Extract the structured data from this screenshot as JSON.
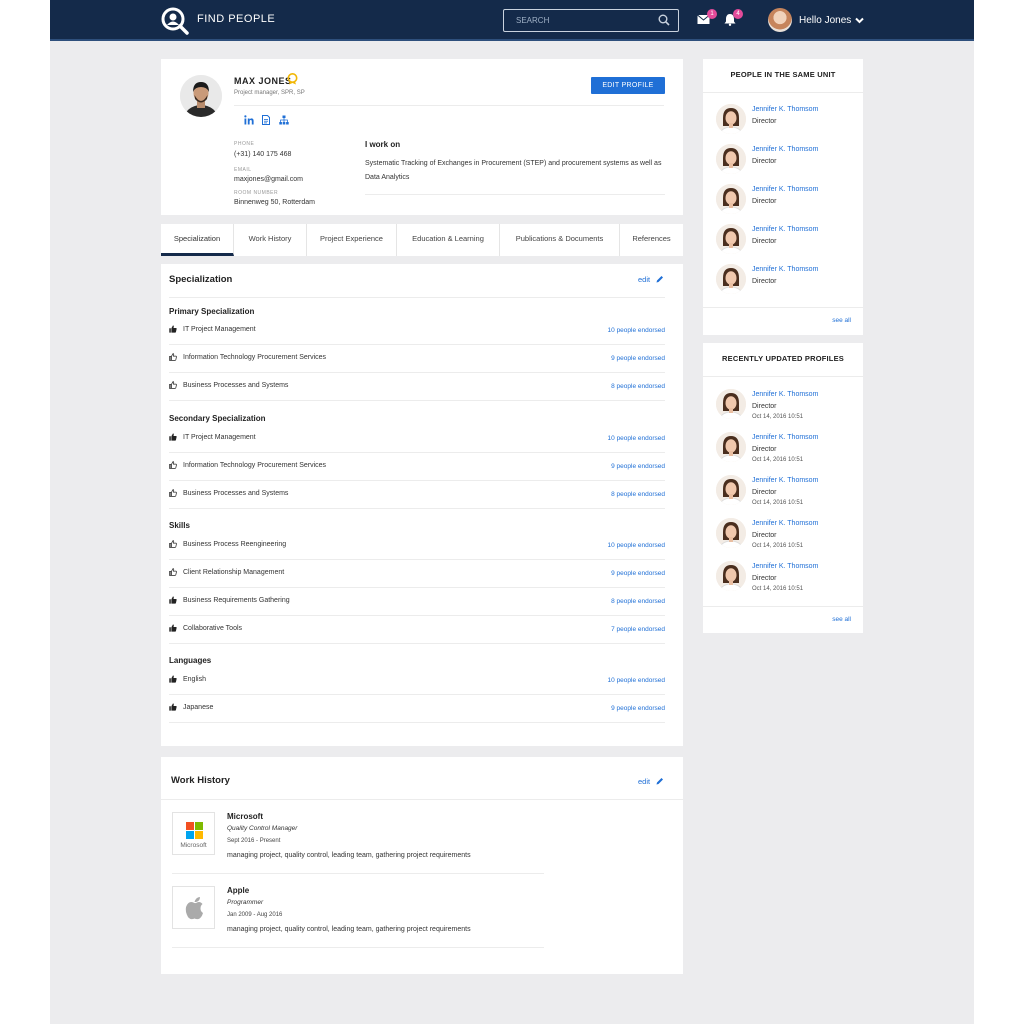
{
  "header": {
    "brand": "FIND PEOPLE",
    "search_placeholder": "SEARCH",
    "mail_count": "1",
    "notif_count": "4",
    "greeting": "Hello Jones"
  },
  "profile": {
    "name": "MAX JONES",
    "title": "Project manager, SPR, SP",
    "edit_label": "EDIT PROFILE",
    "phone_label": "PHONE",
    "phone": "(+31) 140 175 468",
    "email_label": "EMAIL",
    "email": "maxjones@gmail.com",
    "room_label": "ROOM NUMBER",
    "room": "Binnenweg 50, Rotterdam",
    "work_on_title": "I work on",
    "work_on_text": "Systematic Tracking of Exchanges in Procurement (STEP) and procurement systems as well as Data Analytics",
    "social": [
      "linkedin-icon",
      "document-icon",
      "org-chart-icon"
    ]
  },
  "tabs": [
    "Specialization",
    "Work History",
    "Project Experience",
    "Education & Learning",
    "Publications & Documents",
    "References"
  ],
  "specialization": {
    "title": "Specialization",
    "edit_label": "edit",
    "groups": [
      {
        "title": "Primary Specialization",
        "items": [
          {
            "label": "IT Project Management",
            "endorsed": "10 people endorsed",
            "filled": true
          },
          {
            "label": "Information Technology Procurement Services",
            "endorsed": "9 people endorsed",
            "filled": false
          },
          {
            "label": "Business Processes and Systems",
            "endorsed": "8 people endorsed",
            "filled": false
          }
        ]
      },
      {
        "title": "Secondary Specialization",
        "items": [
          {
            "label": "IT Project Management",
            "endorsed": "10 people endorsed",
            "filled": true
          },
          {
            "label": "Information Technology Procurement Services",
            "endorsed": "9 people endorsed",
            "filled": false
          },
          {
            "label": "Business Processes and Systems",
            "endorsed": "8 people endorsed",
            "filled": false
          }
        ]
      },
      {
        "title": "Skills",
        "items": [
          {
            "label": "Business Process Reengineering",
            "endorsed": "10 people endorsed",
            "filled": false
          },
          {
            "label": "Client Relationship Management",
            "endorsed": "9 people endorsed",
            "filled": false
          },
          {
            "label": "Business Requirements Gathering",
            "endorsed": "8 people endorsed",
            "filled": true
          },
          {
            "label": "Collaborative Tools",
            "endorsed": "7 people endorsed",
            "filled": true
          }
        ]
      },
      {
        "title": "Languages",
        "items": [
          {
            "label": "English",
            "endorsed": "10 people endorsed",
            "filled": true
          },
          {
            "label": "Japanese",
            "endorsed": "9 people endorsed",
            "filled": true
          }
        ]
      }
    ]
  },
  "work_history": {
    "title": "Work History",
    "edit_label": "edit",
    "jobs": [
      {
        "company": "Microsoft",
        "logo_text": "Microsoft",
        "role": "Quality Control Manager",
        "dates": "Sept 2016 - Present",
        "desc": "managing project, quality control, leading team, gathering project requirements"
      },
      {
        "company": "Apple",
        "logo_text": "",
        "role": "Programmer",
        "dates": "Jan 2009 - Aug 2016",
        "desc": "managing project, quality control, leading team, gathering project requirements"
      }
    ]
  },
  "same_unit": {
    "title": "PEOPLE IN THE SAME UNIT",
    "see_all": "see all",
    "people": [
      {
        "name": "Jennifer K. Thomsom",
        "role": "Director"
      },
      {
        "name": "Jennifer K. Thomsom",
        "role": "Director"
      },
      {
        "name": "Jennifer K. Thomsom",
        "role": "Director"
      },
      {
        "name": "Jennifer K. Thomsom",
        "role": "Director"
      },
      {
        "name": "Jennifer K. Thomsom",
        "role": "Director"
      }
    ]
  },
  "recent": {
    "title": "RECENTLY UPDATED PROFILES",
    "see_all": "see all",
    "people": [
      {
        "name": "Jennifer K. Thomsom",
        "role": "Director",
        "date": "Oct 14, 2016 10:51"
      },
      {
        "name": "Jennifer K. Thomsom",
        "role": "Director",
        "date": "Oct 14, 2016 10:51"
      },
      {
        "name": "Jennifer K. Thomsom",
        "role": "Director",
        "date": "Oct 14, 2016 10:51"
      },
      {
        "name": "Jennifer K. Thomsom",
        "role": "Director",
        "date": "Oct 14, 2016 10:51"
      },
      {
        "name": "Jennifer K. Thomsom",
        "role": "Director",
        "date": "Oct 14, 2016 10:51"
      }
    ]
  },
  "colors": {
    "nav": "#142a4a",
    "accent": "#1f6fd6",
    "badge": "#e34b9a",
    "background": "#ececee"
  }
}
